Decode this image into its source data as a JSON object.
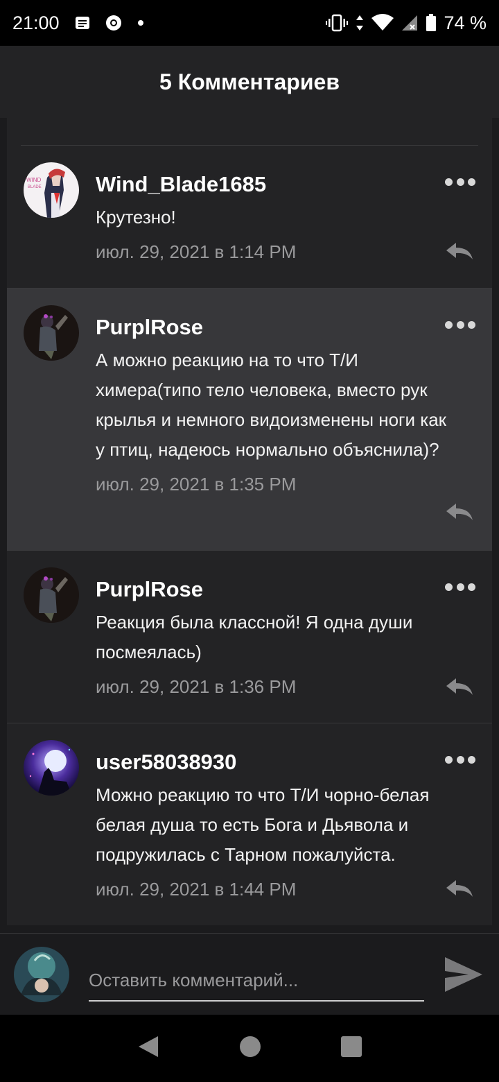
{
  "status_bar": {
    "time": "21:00",
    "battery": "74 %",
    "icons": [
      "notes-icon",
      "chrome-icon",
      "dot-icon",
      "vibrate-icon",
      "data-arrows-icon",
      "wifi-icon",
      "signal-icon",
      "battery-icon"
    ]
  },
  "header": {
    "title": "5 Комментариев"
  },
  "comments": [
    {
      "username": "Wind_Blade1685",
      "text": "Крутезно!",
      "date": "июл. 29, 2021 в 1:14 PM",
      "avatar_text": "WIND BLADE"
    },
    {
      "username": "PurplRose",
      "text": "А можно реакцию на то что Т/И химера(типо тело человека, вместо рук крылья и немного видоизменены ноги как у птиц, надеюсь нормально объяснила)?",
      "date": "июл. 29, 2021 в 1:35 PM",
      "highlighted": true
    },
    {
      "username": "PurplRose",
      "text": "Реакция была классной! Я одна души посмеялась)",
      "date": "июл. 29, 2021 в 1:36 PM"
    },
    {
      "username": "user58038930",
      "text": "Можно реакцию то что Т/И чорно-белая белая душа то есть Бога и Дьявола и подружилась с Тарном пожалуйста.",
      "date": "июл. 29, 2021 в 1:44 PM"
    }
  ],
  "composer": {
    "placeholder": "Оставить комментарий..."
  },
  "colors": {
    "background": "#1b1b1d",
    "card": "#232325",
    "highlight": "#37373a",
    "muted": "#9a9a9c"
  }
}
